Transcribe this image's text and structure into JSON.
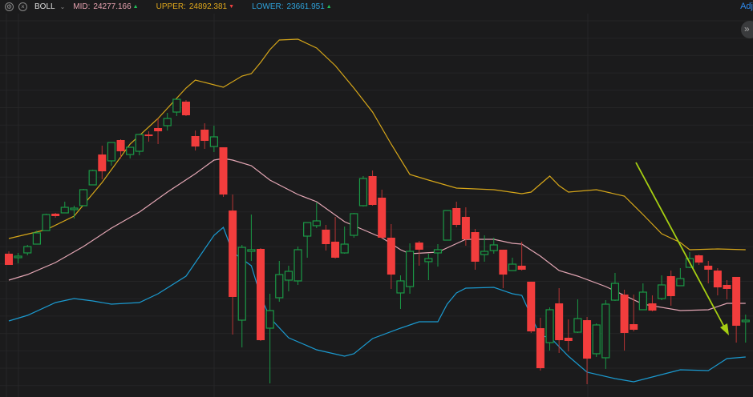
{
  "header": {
    "indicator": "BOLL",
    "mid_label": "MID:",
    "mid_value": "24277.166",
    "mid_dir": "▲",
    "upper_label": "UPPER:",
    "upper_value": "24892.381",
    "upper_dir": "▼",
    "lower_label": "LOWER:",
    "lower_value": "23661.951",
    "lower_dir": "▲",
    "adj_label": "Adj",
    "expand_icon": "»"
  },
  "colors": {
    "background": "#1b1b1c",
    "up": "#1a9a46",
    "down": "#f23d3d",
    "mid": "#e3a6b4",
    "upper": "#d6a619",
    "lower": "#1b9ad0",
    "trendline": "#a6cf12",
    "mid_text": "#e7a3b0",
    "upper_text": "#e0a81c",
    "lower_text": "#2ea3dc"
  },
  "chart_data": {
    "type": "candlestick",
    "indicator": "BOLL",
    "grid": true,
    "candles_ohlc": [
      [
        24848,
        24875,
        24719,
        24719
      ],
      [
        24802,
        24857,
        24737,
        24820
      ],
      [
        24857,
        24949,
        24829,
        24930
      ],
      [
        24958,
        25114,
        24958,
        25087
      ],
      [
        25114,
        25308,
        25114,
        25298
      ],
      [
        25308,
        25317,
        25262,
        25280
      ],
      [
        25317,
        25446,
        25317,
        25381
      ],
      [
        25354,
        25400,
        25252,
        25372
      ],
      [
        25400,
        25593,
        25400,
        25584
      ],
      [
        25639,
        25814,
        25639,
        25804
      ],
      [
        25988,
        26090,
        25703,
        25795
      ],
      [
        25915,
        26126,
        25860,
        26126
      ],
      [
        26154,
        26163,
        25942,
        26025
      ],
      [
        25988,
        26071,
        25942,
        26071
      ],
      [
        26025,
        26228,
        25979,
        26218
      ],
      [
        26218,
        26255,
        26136,
        26200
      ],
      [
        26292,
        26402,
        26108,
        26255
      ],
      [
        26320,
        26467,
        26264,
        26402
      ],
      [
        26476,
        26623,
        26430,
        26623
      ],
      [
        26596,
        26614,
        26430,
        26439
      ],
      [
        26200,
        26264,
        26034,
        26080
      ],
      [
        26274,
        26347,
        26053,
        26145
      ],
      [
        26080,
        26320,
        26016,
        26191
      ],
      [
        26071,
        26071,
        25501,
        25528
      ],
      [
        25344,
        25528,
        23918,
        24351
      ],
      [
        24084,
        24949,
        23771,
        24921
      ],
      [
        24875,
        25298,
        24765,
        24894
      ],
      [
        24903,
        24912,
        23845,
        23854
      ],
      [
        23992,
        24388,
        23357,
        24194
      ],
      [
        24342,
        24765,
        24296,
        24608
      ],
      [
        24544,
        24710,
        24415,
        24645
      ],
      [
        24535,
        24930,
        24489,
        24894
      ],
      [
        25050,
        25206,
        24802,
        25206
      ],
      [
        25170,
        25436,
        25142,
        25225
      ],
      [
        25124,
        25179,
        24884,
        24958
      ],
      [
        24986,
        25271,
        24792,
        24802
      ],
      [
        24857,
        25160,
        24848,
        24958
      ],
      [
        25059,
        25317,
        25032,
        25308
      ],
      [
        25400,
        25740,
        25390,
        25712
      ],
      [
        25740,
        25804,
        25400,
        25409
      ],
      [
        25492,
        25584,
        25022,
        25032
      ],
      [
        25032,
        25188,
        24443,
        24608
      ],
      [
        24397,
        24599,
        24213,
        24535
      ],
      [
        24470,
        24967,
        24388,
        24875
      ],
      [
        24976,
        24995,
        24710,
        24894
      ],
      [
        24756,
        24848,
        24544,
        24792
      ],
      [
        24857,
        24958,
        24700,
        24894
      ],
      [
        25004,
        25344,
        25004,
        25344
      ],
      [
        25372,
        25446,
        25151,
        25179
      ],
      [
        25271,
        25381,
        24940,
        25013
      ],
      [
        25096,
        25133,
        24664,
        24756
      ],
      [
        24838,
        25059,
        24756,
        24875
      ],
      [
        24884,
        25032,
        24848,
        24949
      ],
      [
        24894,
        24894,
        24452,
        24608
      ],
      [
        24654,
        24802,
        24654,
        24728
      ],
      [
        24710,
        24986,
        24654,
        24664
      ],
      [
        24526,
        24526,
        23937,
        23955
      ],
      [
        23992,
        24112,
        23504,
        23532
      ],
      [
        23826,
        24231,
        23734,
        24204
      ],
      [
        24277,
        24452,
        23707,
        23854
      ],
      [
        23882,
        24093,
        23725,
        23845
      ],
      [
        23946,
        24323,
        23937,
        24102
      ],
      [
        24084,
        24121,
        23348,
        23642
      ],
      [
        23698,
        24047,
        23661,
        24029
      ],
      [
        23652,
        24314,
        23523,
        24268
      ],
      [
        24314,
        24627,
        24305,
        24507
      ],
      [
        24378,
        24434,
        23734,
        23937
      ],
      [
        24038,
        24378,
        23955,
        23974
      ],
      [
        24204,
        24507,
        24204,
        24406
      ],
      [
        24277,
        24369,
        24185,
        24194
      ],
      [
        24332,
        24599,
        24314,
        24489
      ],
      [
        24590,
        24654,
        24250,
        24360
      ],
      [
        24480,
        24682,
        24480,
        24562
      ],
      [
        24691,
        24866,
        24682,
        24792
      ],
      [
        24829,
        24838,
        24719,
        24746
      ],
      [
        24710,
        24765,
        24507,
        24664
      ],
      [
        24654,
        24682,
        24369,
        24461
      ],
      [
        24489,
        24544,
        24323,
        24443
      ],
      [
        24581,
        24581,
        23826,
        24020
      ],
      [
        24066,
        24148,
        23826,
        24084
      ]
    ],
    "series": [
      {
        "name": "UPPER",
        "points": [
          [
            0,
            25022
          ],
          [
            4,
            25124
          ],
          [
            7,
            25280
          ],
          [
            10,
            25666
          ],
          [
            13,
            26108
          ],
          [
            16,
            26402
          ],
          [
            19,
            26752
          ],
          [
            20,
            26844
          ],
          [
            23,
            26761
          ],
          [
            25,
            26890
          ],
          [
            26,
            26918
          ],
          [
            27,
            27046
          ],
          [
            28,
            27194
          ],
          [
            29,
            27304
          ],
          [
            31,
            27313
          ],
          [
            33,
            27212
          ],
          [
            35,
            27010
          ],
          [
            37,
            26752
          ],
          [
            39,
            26476
          ],
          [
            41,
            26108
          ],
          [
            43,
            25758
          ],
          [
            45,
            25694
          ],
          [
            48,
            25602
          ],
          [
            52,
            25584
          ],
          [
            55,
            25538
          ],
          [
            56,
            25556
          ],
          [
            58,
            25740
          ],
          [
            59,
            25630
          ],
          [
            60,
            25556
          ],
          [
            63,
            25584
          ],
          [
            66,
            25510
          ],
          [
            68,
            25298
          ],
          [
            70,
            25078
          ],
          [
            72,
            24976
          ],
          [
            73,
            24894
          ],
          [
            76,
            24903
          ],
          [
            79,
            24894
          ]
        ]
      },
      {
        "name": "MID",
        "points": [
          [
            0,
            24544
          ],
          [
            2,
            24608
          ],
          [
            5,
            24746
          ],
          [
            8,
            24930
          ],
          [
            11,
            25142
          ],
          [
            14,
            25326
          ],
          [
            17,
            25556
          ],
          [
            20,
            25768
          ],
          [
            22,
            25924
          ],
          [
            23,
            25942
          ],
          [
            24,
            25924
          ],
          [
            26,
            25860
          ],
          [
            28,
            25694
          ],
          [
            31,
            25528
          ],
          [
            33,
            25446
          ],
          [
            36,
            25216
          ],
          [
            40,
            25032
          ],
          [
            42,
            24894
          ],
          [
            43,
            24848
          ],
          [
            46,
            24866
          ],
          [
            47.5,
            24940
          ],
          [
            49,
            25013
          ],
          [
            52,
            25013
          ],
          [
            54,
            24967
          ],
          [
            55,
            24958
          ],
          [
            57,
            24820
          ],
          [
            59,
            24654
          ],
          [
            61,
            24590
          ],
          [
            64,
            24470
          ],
          [
            68,
            24268
          ],
          [
            72,
            24194
          ],
          [
            75,
            24204
          ],
          [
            77,
            24277
          ],
          [
            79,
            24277
          ]
        ]
      },
      {
        "name": "LOWER",
        "points": [
          [
            0,
            24075
          ],
          [
            2,
            24139
          ],
          [
            5,
            24286
          ],
          [
            7,
            24332
          ],
          [
            9,
            24305
          ],
          [
            11,
            24268
          ],
          [
            14,
            24286
          ],
          [
            16,
            24388
          ],
          [
            19,
            24590
          ],
          [
            22,
            25059
          ],
          [
            23,
            25151
          ],
          [
            24,
            24866
          ],
          [
            26,
            24710
          ],
          [
            27,
            24360
          ],
          [
            28,
            24112
          ],
          [
            30,
            23882
          ],
          [
            33,
            23744
          ],
          [
            36,
            23670
          ],
          [
            37,
            23698
          ],
          [
            39,
            23872
          ],
          [
            42,
            23992
          ],
          [
            44,
            24066
          ],
          [
            46,
            24066
          ],
          [
            47,
            24268
          ],
          [
            48,
            24397
          ],
          [
            49,
            24452
          ],
          [
            52,
            24461
          ],
          [
            54,
            24388
          ],
          [
            55,
            24369
          ],
          [
            57,
            23900
          ],
          [
            58,
            23891
          ],
          [
            60,
            23670
          ],
          [
            62,
            23486
          ],
          [
            65,
            23412
          ],
          [
            67,
            23376
          ],
          [
            71,
            23486
          ],
          [
            72,
            23514
          ],
          [
            75,
            23504
          ],
          [
            77,
            23642
          ],
          [
            79,
            23661
          ]
        ]
      }
    ]
  }
}
